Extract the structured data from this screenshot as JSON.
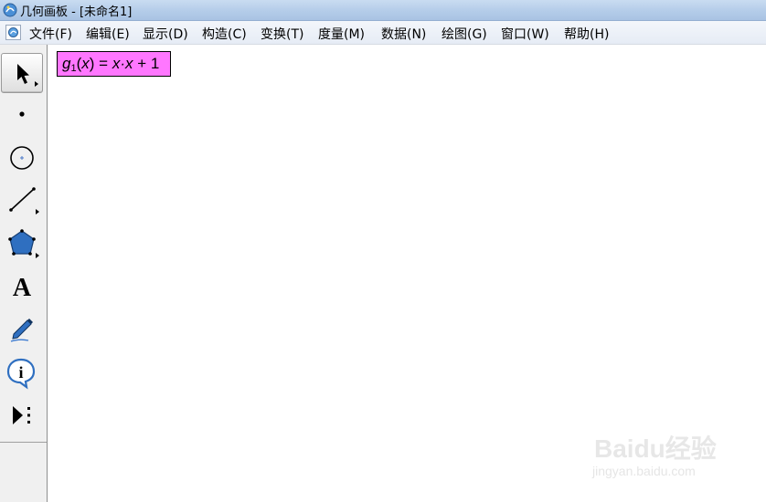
{
  "window": {
    "title": "几何画板 - [未命名1]"
  },
  "menu": {
    "items": [
      "文件(F)",
      "编辑(E)",
      "显示(D)",
      "构造(C)",
      "变换(T)",
      "度量(M)",
      "数据(N)",
      "绘图(G)",
      "窗口(W)",
      "帮助(H)"
    ]
  },
  "toolbox": {
    "tools": [
      {
        "name": "arrow-select-tool",
        "icon": "arrow-pointer-icon",
        "selected": true
      },
      {
        "name": "point-tool",
        "icon": "point-icon"
      },
      {
        "name": "compass-tool",
        "icon": "circle-icon"
      },
      {
        "name": "straightedge-tool",
        "icon": "line-segment-icon"
      },
      {
        "name": "polygon-tool",
        "icon": "pentagon-icon"
      },
      {
        "name": "text-tool",
        "icon": "letter-a-icon",
        "label": "A"
      },
      {
        "name": "marker-tool",
        "icon": "pen-icon"
      },
      {
        "name": "information-tool",
        "icon": "info-icon",
        "label": "i"
      },
      {
        "name": "custom-tool",
        "icon": "play-dots-icon"
      }
    ]
  },
  "canvas": {
    "function_label": {
      "name": "g",
      "subscript": "1",
      "variable": "x",
      "expression_lhs_suffix": ") = ",
      "expression_rhs": "x·x",
      "expression_tail": " + 1",
      "background": "#ff77ff"
    }
  },
  "watermark": {
    "brand": "Baidu经验",
    "url": "jingyan.baidu.com"
  }
}
